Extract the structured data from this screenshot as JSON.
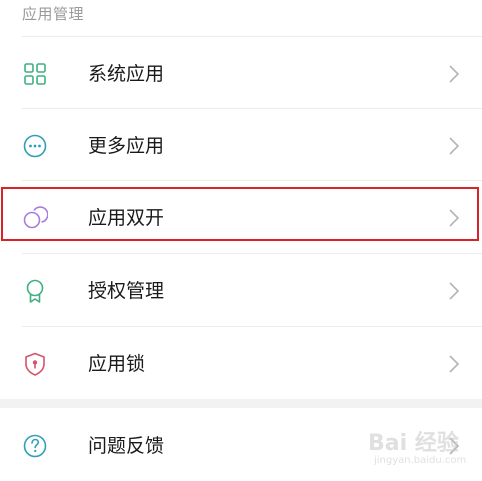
{
  "section": {
    "title": "应用管理"
  },
  "items": [
    {
      "label": "系统应用",
      "icon": "grid-apps-icon",
      "color": "#3fb07f"
    },
    {
      "label": "更多应用",
      "icon": "more-dots-icon",
      "color": "#2f9fb8"
    },
    {
      "label": "应用双开",
      "icon": "dual-circles-icon",
      "color": "#a77ee0"
    },
    {
      "label": "授权管理",
      "icon": "badge-ribbon-icon",
      "color": "#3fb07f"
    },
    {
      "label": "应用锁",
      "icon": "shield-lock-icon",
      "color": "#d6546b"
    },
    {
      "label": "问题反馈",
      "icon": "question-circle-icon",
      "color": "#2f9fb8"
    }
  ],
  "colors": {
    "highlight_border": "#d9232a",
    "label_text": "#1a1a1a",
    "section_header_text": "#9a9a9a",
    "chevron": "#b4b4b4"
  },
  "watermark": {
    "brand": "Bai 经验",
    "url": "jingyan.baidu.com"
  }
}
